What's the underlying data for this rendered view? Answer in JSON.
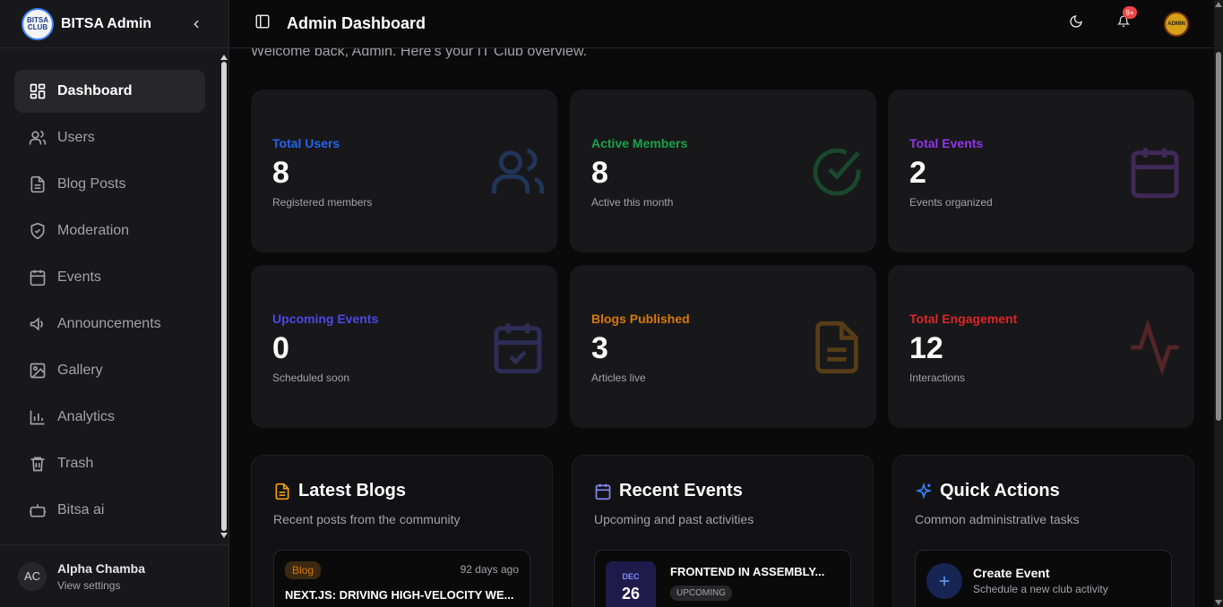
{
  "app": {
    "title": "BITSA Admin",
    "logo_text": "BITSA CLUB"
  },
  "sidebar": {
    "items": [
      {
        "label": "Dashboard",
        "icon": "dashboard-icon",
        "active": true
      },
      {
        "label": "Users",
        "icon": "users-icon"
      },
      {
        "label": "Blog Posts",
        "icon": "file-icon"
      },
      {
        "label": "Moderation",
        "icon": "shield-icon"
      },
      {
        "label": "Events",
        "icon": "calendar-icon"
      },
      {
        "label": "Announcements",
        "icon": "megaphone-icon"
      },
      {
        "label": "Gallery",
        "icon": "image-icon"
      },
      {
        "label": "Analytics",
        "icon": "bar-chart-icon"
      },
      {
        "label": "Trash",
        "icon": "trash-icon"
      },
      {
        "label": "Bitsa ai",
        "icon": "bot-icon"
      }
    ],
    "user": {
      "initials": "AC",
      "name": "Alpha Chamba",
      "sub": "View settings"
    }
  },
  "header": {
    "title": "Admin Dashboard",
    "notification_count": "9+",
    "avatar_text": "ADMIN"
  },
  "main": {
    "welcome": "Welcome back, Admin. Here's your IT Club overview.",
    "stats": [
      {
        "label": "Total Users",
        "value": "8",
        "sub": "Registered members",
        "color": "#2563eb",
        "icon": "users-icon"
      },
      {
        "label": "Active Members",
        "value": "8",
        "sub": "Active this month",
        "color": "#16a34a",
        "icon": "check-circle-icon"
      },
      {
        "label": "Total Events",
        "value": "2",
        "sub": "Events organized",
        "color": "#9333ea",
        "icon": "calendar-icon"
      },
      {
        "label": "Upcoming Events",
        "value": "0",
        "sub": "Scheduled soon",
        "color": "#4f46e5",
        "icon": "calendar-check-icon"
      },
      {
        "label": "Blogs Published",
        "value": "3",
        "sub": "Articles live",
        "color": "#d97706",
        "icon": "file-text-icon"
      },
      {
        "label": "Total Engagement",
        "value": "12",
        "sub": "Interactions",
        "color": "#dc2626",
        "icon": "activity-icon"
      }
    ],
    "panels": {
      "blogs": {
        "title": "Latest Blogs",
        "sub": "Recent posts from the community",
        "item": {
          "tag": "Blog",
          "time": "92 days ago",
          "title": "NEXT.JS: DRIVING HIGH-VELOCITY WE..."
        }
      },
      "events": {
        "title": "Recent Events",
        "sub": "Upcoming and past activities",
        "item": {
          "month": "DEC",
          "day": "26",
          "title": "FRONTEND IN ASSEMBLY...",
          "status": "UPCOMING"
        }
      },
      "actions": {
        "title": "Quick Actions",
        "sub": "Common administrative tasks",
        "item": {
          "title": "Create Event",
          "sub": "Schedule a new club activity"
        }
      }
    }
  }
}
